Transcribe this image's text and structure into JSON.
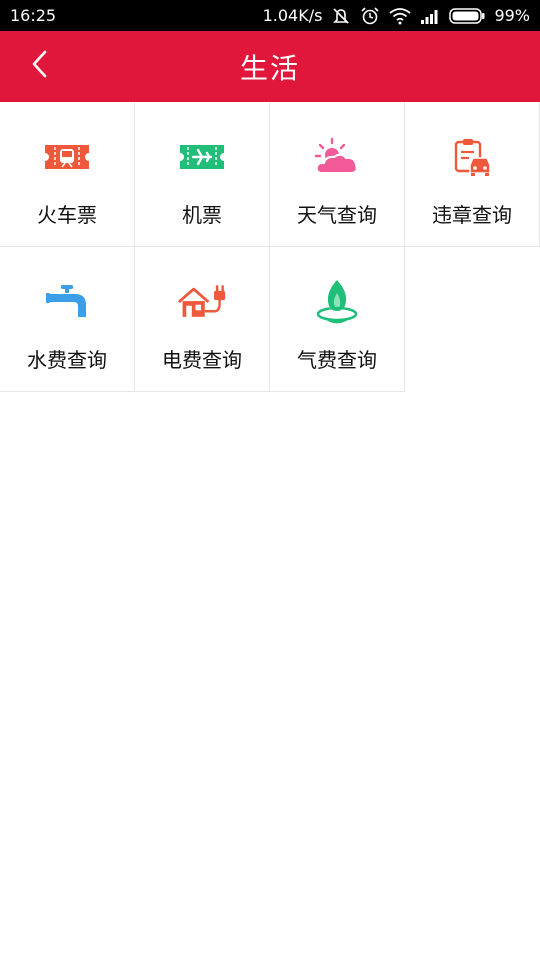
{
  "status_bar": {
    "time": "16:25",
    "speed": "1.04K/s",
    "battery_percent": "99%",
    "icons": [
      "mute-icon",
      "alarm-icon",
      "wifi-icon",
      "signal-icon",
      "battery-icon"
    ]
  },
  "header": {
    "title": "生活",
    "back_icon": "chevron-left-icon",
    "background": "#e0173a"
  },
  "grid": {
    "items": [
      {
        "label": "火车票",
        "icon": "train-ticket-icon",
        "color": "#f0583c"
      },
      {
        "label": "机票",
        "icon": "plane-ticket-icon",
        "color": "#1fbf7a"
      },
      {
        "label": "天气查询",
        "icon": "weather-icon",
        "color": "#f25a98"
      },
      {
        "label": "违章查询",
        "icon": "traffic-violation-icon",
        "color": "#f0583c"
      },
      {
        "label": "水费查询",
        "icon": "water-tap-icon",
        "color": "#3a9ee8"
      },
      {
        "label": "电费查询",
        "icon": "electric-house-icon",
        "color": "#f0583c"
      },
      {
        "label": "气费查询",
        "icon": "gas-flame-icon",
        "color": "#1fbf7a"
      }
    ]
  }
}
